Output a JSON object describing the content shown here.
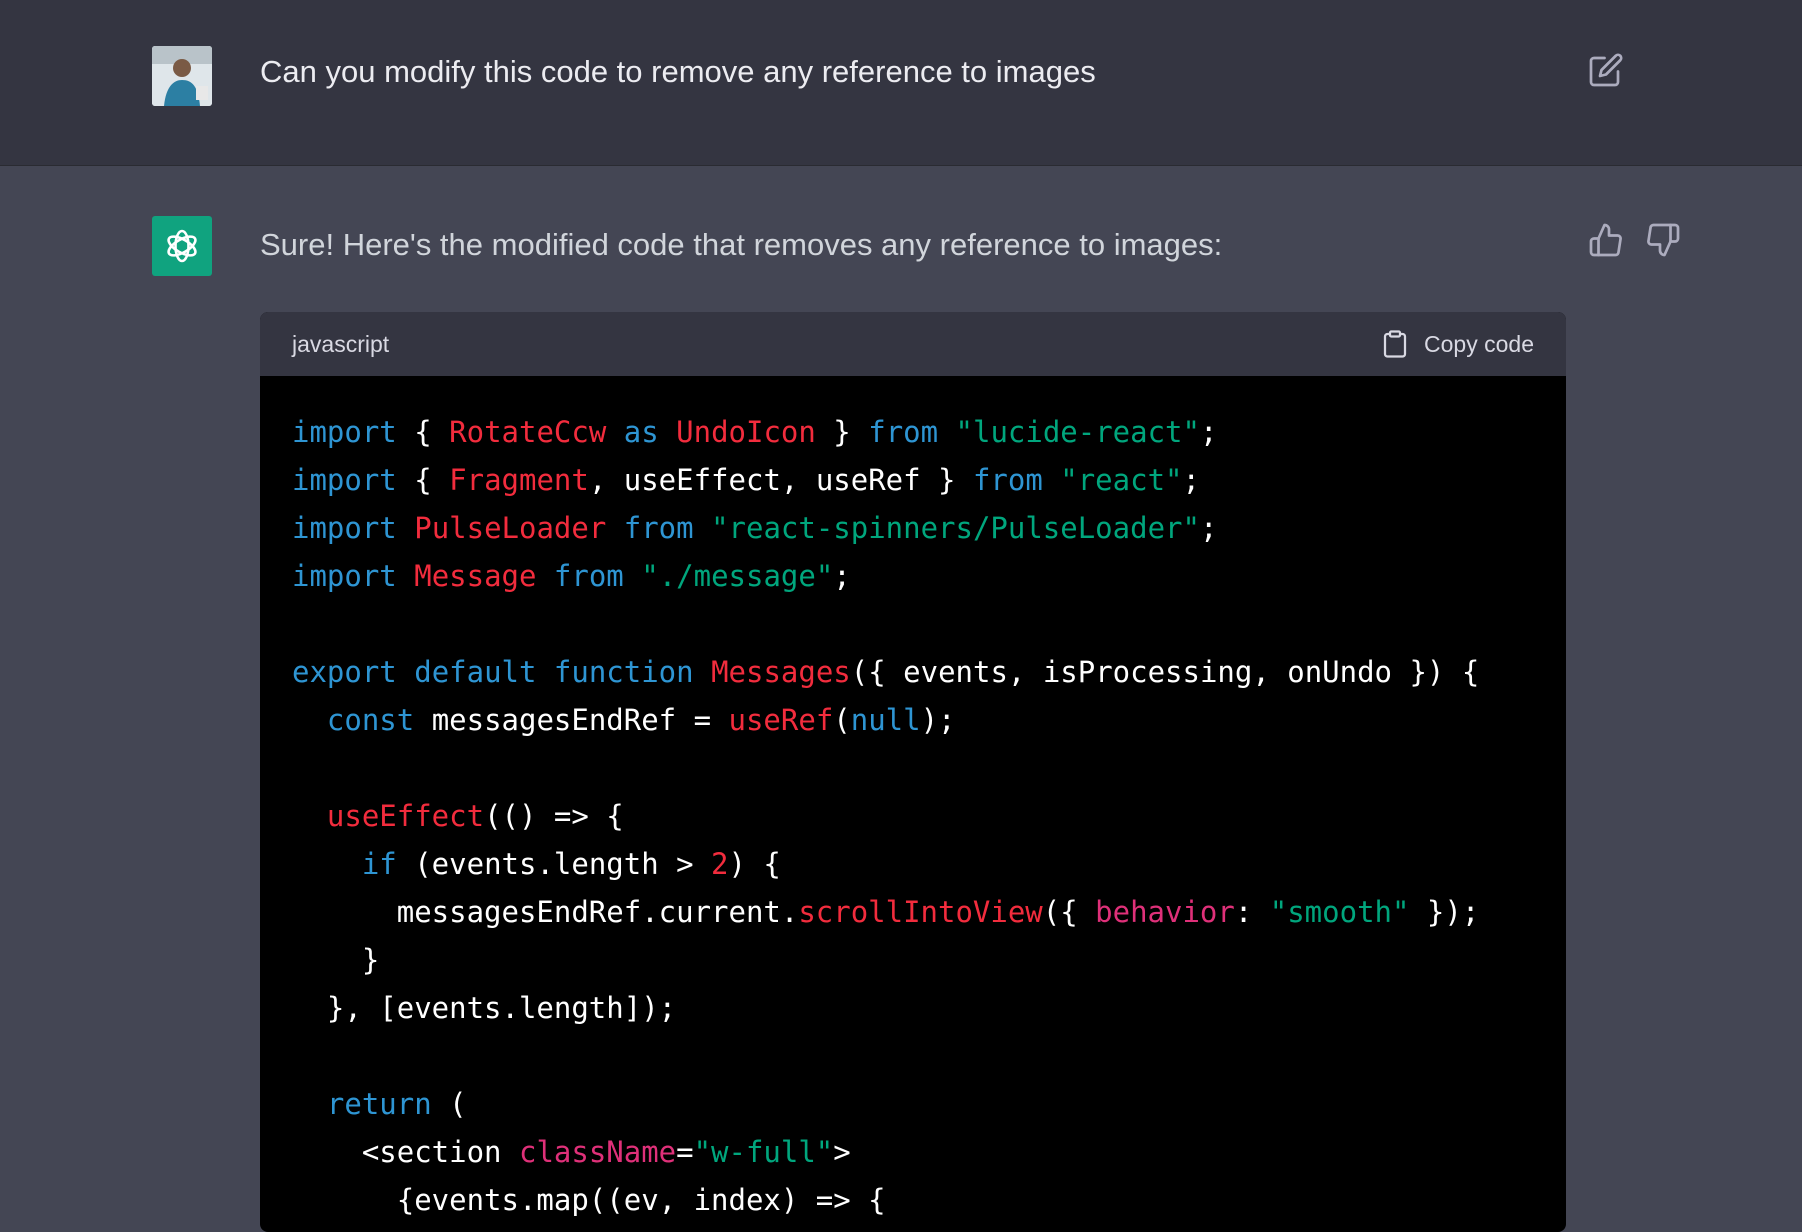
{
  "user_message": {
    "text": "Can you modify this code to remove any reference to images",
    "avatar": "user-photo",
    "edit_icon": "edit-icon"
  },
  "assistant_message": {
    "text": "Sure! Here's the modified code that removes any reference to images:",
    "avatar": "openai-logo",
    "thumbs_up_icon": "thumbs-up-icon",
    "thumbs_down_icon": "thumbs-down-icon"
  },
  "code_block": {
    "language": "javascript",
    "copy_label": "Copy code",
    "lines": [
      [
        [
          "k",
          "import"
        ],
        [
          "p",
          " { "
        ],
        [
          "n",
          "RotateCcw"
        ],
        [
          "p",
          " "
        ],
        [
          "k",
          "as"
        ],
        [
          "p",
          " "
        ],
        [
          "n",
          "UndoIcon"
        ],
        [
          "p",
          " } "
        ],
        [
          "k",
          "from"
        ],
        [
          "p",
          " "
        ],
        [
          "s",
          "\"lucide-react\""
        ],
        [
          "p",
          ";"
        ]
      ],
      [
        [
          "k",
          "import"
        ],
        [
          "p",
          " { "
        ],
        [
          "n",
          "Fragment"
        ],
        [
          "p",
          ", useEffect, useRef } "
        ],
        [
          "k",
          "from"
        ],
        [
          "p",
          " "
        ],
        [
          "s",
          "\"react\""
        ],
        [
          "p",
          ";"
        ]
      ],
      [
        [
          "k",
          "import"
        ],
        [
          "p",
          " "
        ],
        [
          "n",
          "PulseLoader"
        ],
        [
          "p",
          " "
        ],
        [
          "k",
          "from"
        ],
        [
          "p",
          " "
        ],
        [
          "s",
          "\"react-spinners/PulseLoader\""
        ],
        [
          "p",
          ";"
        ]
      ],
      [
        [
          "k",
          "import"
        ],
        [
          "p",
          " "
        ],
        [
          "n",
          "Message"
        ],
        [
          "p",
          " "
        ],
        [
          "k",
          "from"
        ],
        [
          "p",
          " "
        ],
        [
          "s",
          "\"./message\""
        ],
        [
          "p",
          ";"
        ]
      ],
      [
        [
          "p",
          ""
        ]
      ],
      [
        [
          "k",
          "export"
        ],
        [
          "p",
          " "
        ],
        [
          "k",
          "default"
        ],
        [
          "p",
          " "
        ],
        [
          "k",
          "function"
        ],
        [
          "p",
          " "
        ],
        [
          "n",
          "Messages"
        ],
        [
          "p",
          "({ events, isProcessing, onUndo }) {"
        ]
      ],
      [
        [
          "p",
          "  "
        ],
        [
          "k",
          "const"
        ],
        [
          "p",
          " messagesEndRef = "
        ],
        [
          "n",
          "useRef"
        ],
        [
          "p",
          "("
        ],
        [
          "k",
          "null"
        ],
        [
          "p",
          ");"
        ]
      ],
      [
        [
          "p",
          ""
        ]
      ],
      [
        [
          "p",
          "  "
        ],
        [
          "n",
          "useEffect"
        ],
        [
          "p",
          "(() => {"
        ]
      ],
      [
        [
          "p",
          "    "
        ],
        [
          "k",
          "if"
        ],
        [
          "p",
          " (events.length > "
        ],
        [
          "n",
          "2"
        ],
        [
          "p",
          ") {"
        ]
      ],
      [
        [
          "p",
          "      messagesEndRef.current."
        ],
        [
          "n",
          "scrollIntoView"
        ],
        [
          "p",
          "({ "
        ],
        [
          "a",
          "behavior"
        ],
        [
          "p",
          ": "
        ],
        [
          "s",
          "\"smooth\""
        ],
        [
          "p",
          " });"
        ]
      ],
      [
        [
          "p",
          "    }"
        ]
      ],
      [
        [
          "p",
          "  }, [events.length]);"
        ]
      ],
      [
        [
          "p",
          ""
        ]
      ],
      [
        [
          "p",
          "  "
        ],
        [
          "k",
          "return"
        ],
        [
          "p",
          " ("
        ]
      ],
      [
        [
          "p",
          "    <section "
        ],
        [
          "a",
          "className"
        ],
        [
          "p",
          "="
        ],
        [
          "s",
          "\"w-full\""
        ],
        [
          "p",
          ">"
        ]
      ],
      [
        [
          "p",
          "      {events.map((ev, index) => {"
        ]
      ]
    ]
  }
}
